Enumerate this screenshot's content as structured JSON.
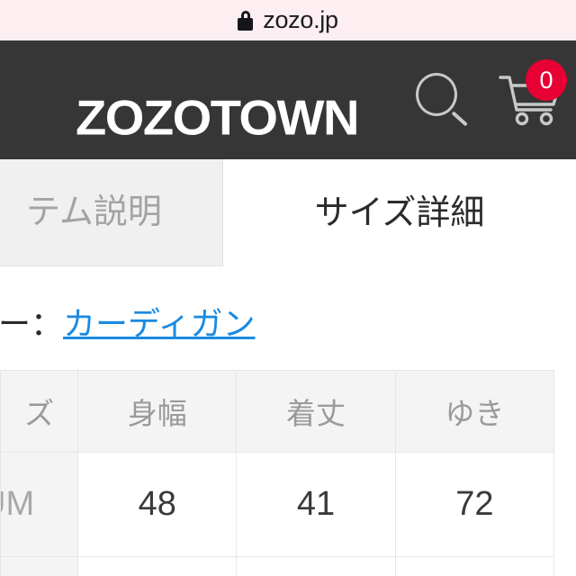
{
  "browser": {
    "lock_icon": "lock-icon",
    "url": "zozo.jp"
  },
  "header": {
    "logo": "ZOZOTOWN",
    "search_icon": "search-icon",
    "cart_icon": "shopping-cart-icon",
    "cart_badge_count": "0",
    "background_color": "#363636",
    "badge_color": "#e60033"
  },
  "tabs": [
    {
      "label": "テム説明",
      "full_label": "アイテム説明",
      "active": false
    },
    {
      "label": "サイズ詳細",
      "full_label": "サイズ詳細",
      "active": true
    }
  ],
  "category": {
    "label": "リー：",
    "full_label": "カテゴリー：",
    "link_text": "カーディガン",
    "link_color": "#1a8ae0"
  },
  "size_table": {
    "headers": [
      "ズ",
      "身幅",
      "着丈",
      "ゆき"
    ],
    "full_headers": [
      "サイズ",
      "身幅",
      "着丈",
      "ゆき"
    ],
    "rows": [
      {
        "size": "UM",
        "full_size": "MEDIUM",
        "values": [
          "48",
          "41",
          "72"
        ]
      }
    ]
  }
}
